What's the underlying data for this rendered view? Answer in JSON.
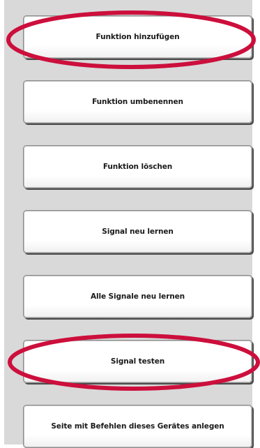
{
  "menu": {
    "items": [
      {
        "label": "Funktion hinzufügen",
        "highlighted": true
      },
      {
        "label": "Funktion umbenennen",
        "highlighted": false
      },
      {
        "label": "Funktion löschen",
        "highlighted": false
      },
      {
        "label": "Signal neu lernen",
        "highlighted": false
      },
      {
        "label": "Alle Signale neu lernen",
        "highlighted": false
      },
      {
        "label": "Signal testen",
        "highlighted": true
      },
      {
        "label": "Seite mit Befehlen dieses Gerätes anlegen",
        "highlighted": false
      }
    ]
  },
  "colors": {
    "panel_background": "#d9d9d9",
    "button_background": "#ffffff",
    "highlight_ellipse": "#cc0f3c"
  }
}
